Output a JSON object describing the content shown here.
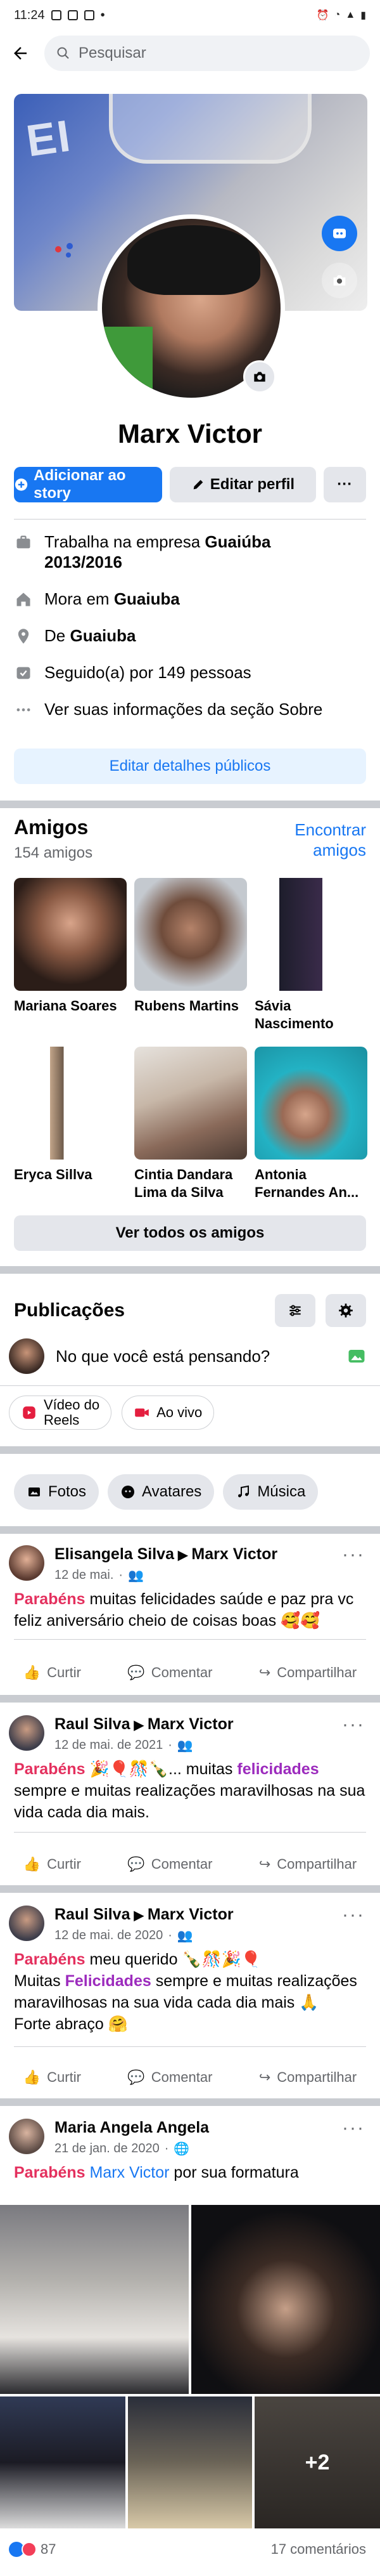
{
  "status_bar": {
    "time": "11:24",
    "extra": "•"
  },
  "search": {
    "placeholder": "Pesquisar"
  },
  "profile": {
    "name": "Marx Victor",
    "add_story_label": "Adicionar ao story",
    "edit_profile_label": "Editar perfil",
    "more_label": "···"
  },
  "info": {
    "work_prefix": "Trabalha na empresa ",
    "work_company": "Guaiúba",
    "work_years": "2013/2016",
    "lives_prefix": "Mora em ",
    "lives_city": "Guaiuba",
    "from_prefix": "De ",
    "from_city": "Guaiuba",
    "followers": "Seguido(a) por 149 pessoas",
    "about_link": "Ver suas informações da seção Sobre",
    "edit_public_label": "Editar detalhes públicos"
  },
  "friends": {
    "title": "Amigos",
    "count": "154 amigos",
    "find_label_line1": "Encontrar",
    "find_label_line2": "amigos",
    "see_all_label": "Ver todos os amigos",
    "items": [
      {
        "name": "Mariana Soares"
      },
      {
        "name": "Rubens Martins"
      },
      {
        "name": "Sávia Nascimento"
      },
      {
        "name": "Eryca Sillva"
      },
      {
        "name": "Cintia Dandara Lima da Silva"
      },
      {
        "name": "Antonia Fernandes An..."
      }
    ]
  },
  "publications": {
    "title": "Publicações",
    "composer_placeholder": "No que você está pensando?",
    "reels_label_line1": "Vídeo do",
    "reels_label_line2": "Reels",
    "live_label": "Ao vivo",
    "filters": [
      "Fotos",
      "Avatares",
      "Música"
    ]
  },
  "posts": [
    {
      "author": "Elisangela Silva",
      "target": "Marx Victor",
      "date": "12 de mai.",
      "text_hl": "Parabéns",
      "text": " muitas felicidades saúde e paz pra vc feliz aniversário cheio de coisas boas 🥰🥰"
    },
    {
      "author": "Raul Silva",
      "target": "Marx Victor",
      "date": "12 de mai. de 2021",
      "text_hl": "Parabéns",
      "text_a": " 🎉🎈🎊🍾... muitas ",
      "text_hl2": "felicidades",
      "text_b": " sempre e muitas realizações maravilhosas na sua vida cada dia mais."
    },
    {
      "author": "Raul Silva",
      "target": "Marx Victor",
      "date": "12 de mai. de 2020",
      "text_hl": "Parabéns",
      "text_a": " meu querido 🍾🎊🎉🎈",
      "text_line2_prefix": "Muitas ",
      "text_hl2": "Felicidades",
      "text_b": " sempre e muitas realizações maravilhosas na sua vida cada dia mais 🙏",
      "text_c": "Forte abraço 🤗"
    },
    {
      "author": "Maria Angela Angela",
      "date": "21 de jan. de 2020",
      "text_hl": "Parabéns",
      "text_link": "Marx Victor",
      "text": " por sua formatura",
      "more_photos": "+2",
      "reactions": "87",
      "comments": "17 comentários"
    }
  ],
  "post_actions": {
    "like": "Curtir",
    "comment": "Comentar",
    "share": "Compartilhar"
  },
  "colors": {
    "accent": "#1877f2",
    "separator": "#c9ccd1",
    "button_bg": "#e4e6eb",
    "highlight_pink": "#e4305e"
  }
}
